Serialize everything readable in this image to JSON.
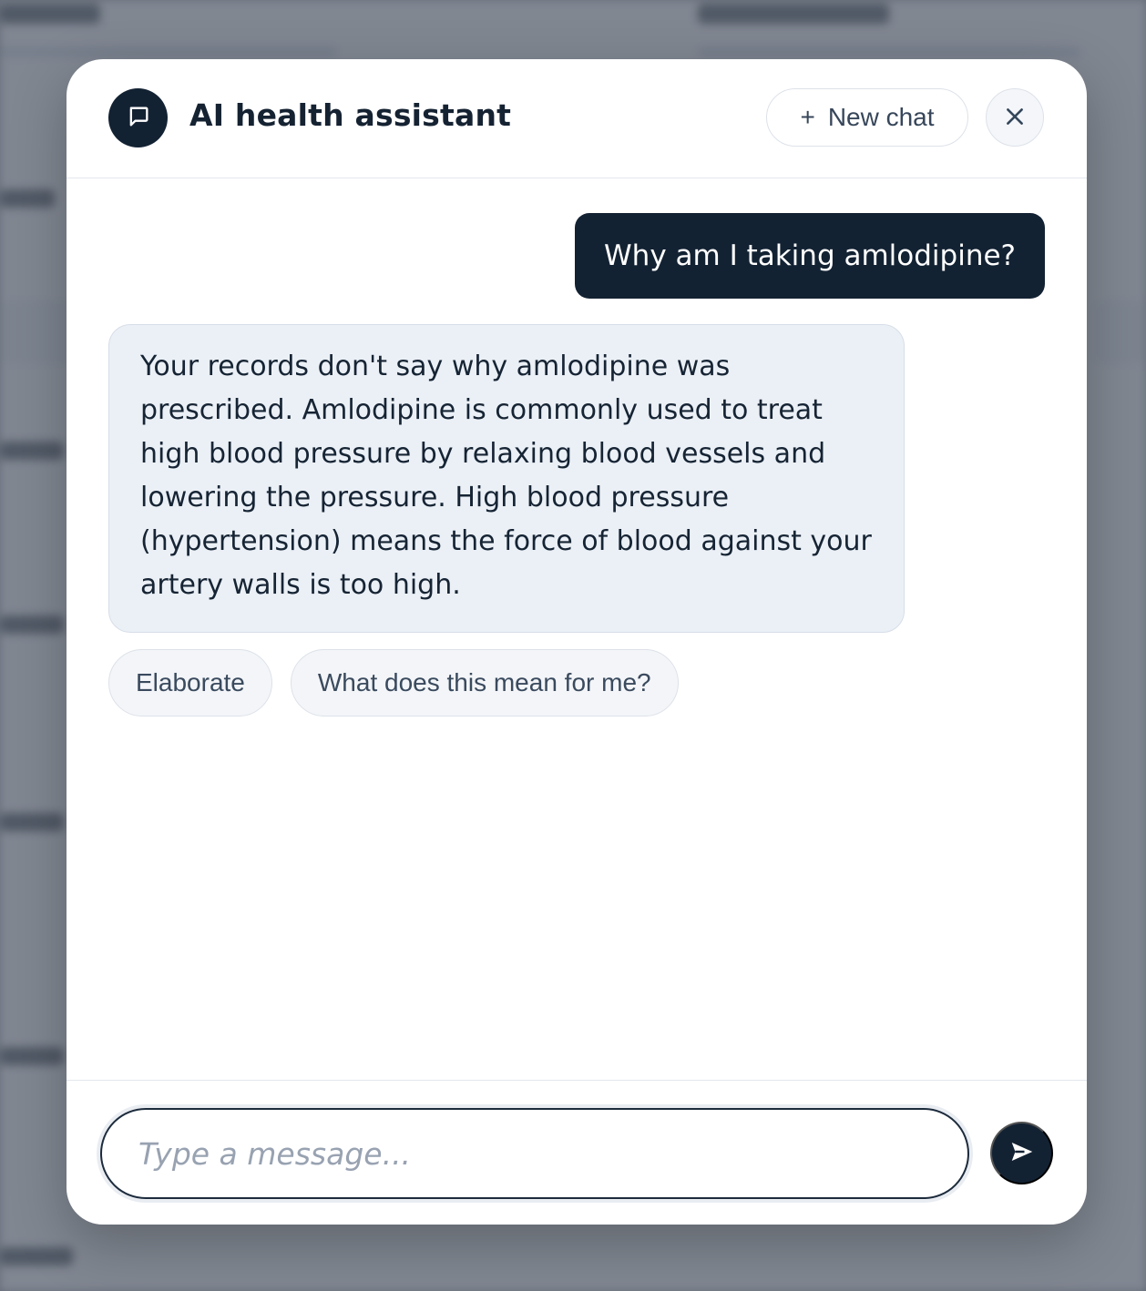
{
  "background": {
    "overlay_color": "#606875"
  },
  "header": {
    "title": "AI health assistant",
    "avatar_icon": "chat-bubble-icon",
    "new_chat_label": "New chat",
    "new_chat_icon": "plus-icon",
    "close_icon": "close-icon"
  },
  "conversation": {
    "user_message": "Why am I taking amlodipine?",
    "assistant_message": "Your records don't say why amlodipine was prescribed. Amlodipine is commonly used to treat high blood pressure by relaxing blood vessels and lowering the pressure. High blood pressure (hypertension) means the force of blood against your artery walls is too high.",
    "suggestions": [
      "Elaborate",
      "What does this mean for me?"
    ]
  },
  "composer": {
    "placeholder": "Type a message...",
    "value": "",
    "send_icon": "send-icon"
  },
  "colors": {
    "primary": "#132233",
    "assistant_bubble": "#ebf0f6",
    "chip_background": "#f3f5f8",
    "border": "#dde2e9"
  }
}
